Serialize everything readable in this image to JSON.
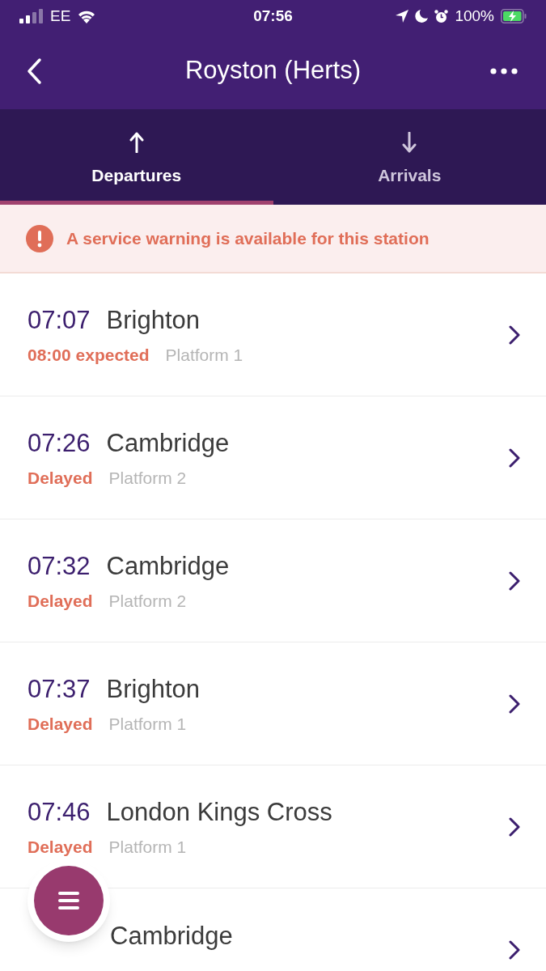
{
  "status_bar": {
    "carrier": "EE",
    "time": "07:56",
    "battery": "100%"
  },
  "header": {
    "title": "Royston (Herts)"
  },
  "tabs": [
    {
      "label": "Departures",
      "selected": true
    },
    {
      "label": "Arrivals",
      "selected": false
    }
  ],
  "warning": {
    "text": "A service warning is available for this station"
  },
  "services": [
    {
      "time": "07:07",
      "destination": "Brighton",
      "status": "08:00 expected",
      "platform": "Platform 1"
    },
    {
      "time": "07:26",
      "destination": "Cambridge",
      "status": "Delayed",
      "platform": "Platform 2"
    },
    {
      "time": "07:32",
      "destination": "Cambridge",
      "status": "Delayed",
      "platform": "Platform 2"
    },
    {
      "time": "07:37",
      "destination": "Brighton",
      "status": "Delayed",
      "platform": "Platform 1"
    },
    {
      "time": "07:46",
      "destination": "London Kings Cross",
      "status": "Delayed",
      "platform": "Platform 1"
    },
    {
      "destination": "Cambridge"
    }
  ]
}
